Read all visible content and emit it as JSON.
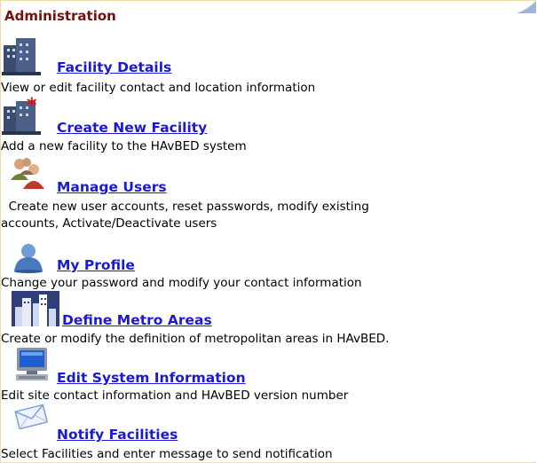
{
  "section": {
    "title": "Administration"
  },
  "items": [
    {
      "icon": "building-icon",
      "label": "Facility Details",
      "desc": "View or edit facility contact and location information"
    },
    {
      "icon": "new-building-icon",
      "label": "Create New Facility",
      "desc": "Add a new facility to the HAvBED system"
    },
    {
      "icon": "users-icon",
      "label": "Manage Users",
      "desc_line1": "  Create new user accounts, reset passwords, modify existing",
      "desc_line2": "accounts, Activate/Deactivate users"
    },
    {
      "icon": "user-icon",
      "label": "My Profile",
      "desc": "Change your password and modify your contact information"
    },
    {
      "icon": "city-skyline-icon",
      "label": "Define Metro Areas",
      "desc": "Create or modify the definition of metropolitan areas in HAvBED."
    },
    {
      "icon": "computer-icon",
      "label": "Edit System Information",
      "desc": "Edit site contact information and HAvBED version number"
    },
    {
      "icon": "envelope-icon",
      "label": "Notify Facilities",
      "desc": "Select Facilities and enter message to send notification"
    }
  ],
  "colors": {
    "header": "#7a0f0f",
    "link": "#1a1ad6",
    "border": "#f0d8a8"
  }
}
